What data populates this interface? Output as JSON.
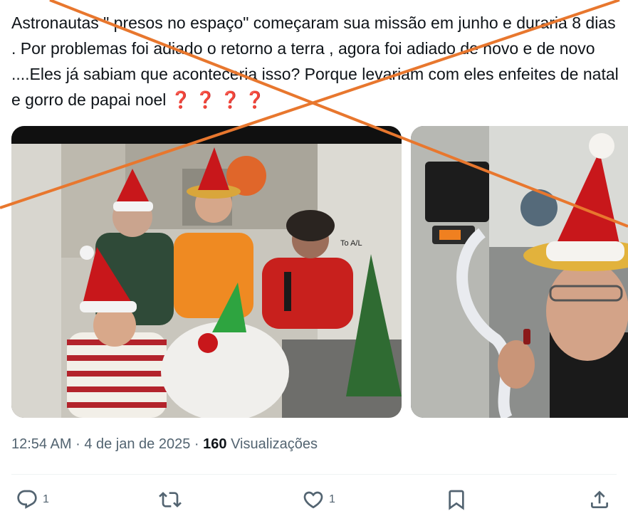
{
  "tweet": {
    "text": "Astronautas \" presos no espaço\" começaram sua missão em junho e duraria 8 dias . Por problemas foi adiado o retorno a terra , agora foi adiado de novo e de novo ....Eles já sabiam que aconteceria isso? Porque levariam com eles enfeites de natal e gorro de papai noel",
    "emoji": "❓❓❓❓"
  },
  "meta": {
    "time": "12:54 AM",
    "separator": "·",
    "date": "4 de jan de 2025",
    "views_count": "160",
    "views_label": "Visualizações"
  },
  "actions": {
    "reply_count": "1",
    "like_count": "1"
  },
  "colors": {
    "overlay_x": "#e8772e",
    "icon": "#536471",
    "question_mark": "#c6132e"
  },
  "icons": [
    "reply-icon",
    "retweet-icon",
    "like-icon",
    "bookmark-icon",
    "share-icon"
  ]
}
